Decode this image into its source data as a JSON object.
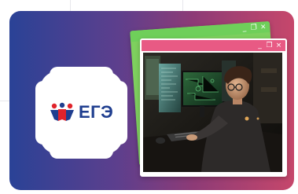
{
  "logo": {
    "text": "ЕГЭ",
    "color": "#1f3e8f",
    "accent_colors": [
      "#e0232b",
      "#1f3e8f"
    ]
  },
  "banner": {
    "gradient": [
      "#2a4296",
      "#5d3f8d",
      "#8e3b76",
      "#c6476b"
    ]
  },
  "windows": {
    "back": {
      "titlebar_color": "#6fcf5a",
      "controls": {
        "minimize": "_",
        "restore": "❐",
        "close": "×"
      }
    },
    "front": {
      "titlebar_color": "#e85a84",
      "controls": {
        "minimize": "_",
        "restore": "❐",
        "close": "×"
      }
    }
  },
  "photo": {
    "subject": "person-at-computer-monitors-icon"
  }
}
